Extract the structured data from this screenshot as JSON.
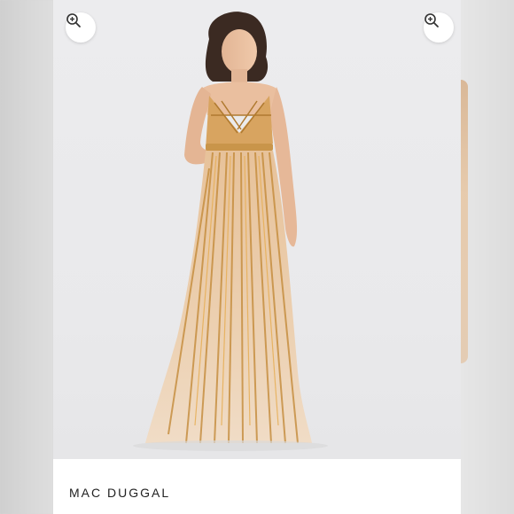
{
  "product": {
    "brand": "MAC DUGGAL"
  },
  "controls": {
    "zoom_left_icon": "zoom-in-icon",
    "zoom_right_icon": "zoom-in-icon"
  },
  "colors": {
    "background": "#d6d6d6",
    "photo_background": "#ececee",
    "gown_base": "#e8c9a6",
    "sequin_gold": "#c8923e"
  }
}
